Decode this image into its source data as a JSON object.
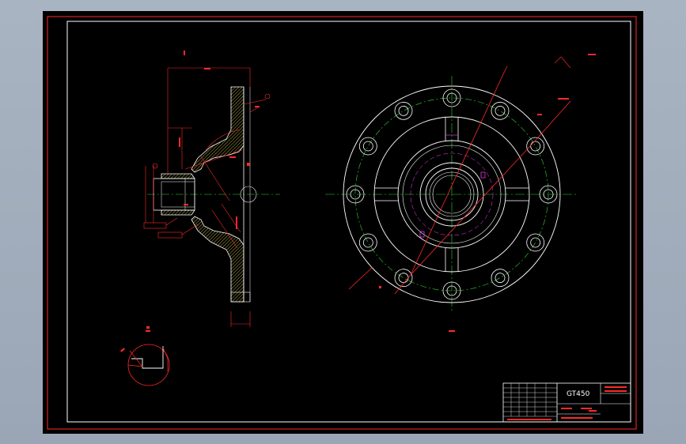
{
  "colors": {
    "background": "#000000",
    "frame": "#ffffff",
    "cad_red": "#ff2a2a",
    "center_green": "#2fd42f",
    "magenta": "#ff40ff",
    "hatch_yellow": "#e0d35a"
  },
  "title_block": {
    "part_code": "GT450",
    "part_name": "",
    "drawing_name": ""
  },
  "notes": {
    "title": "",
    "lines": []
  }
}
